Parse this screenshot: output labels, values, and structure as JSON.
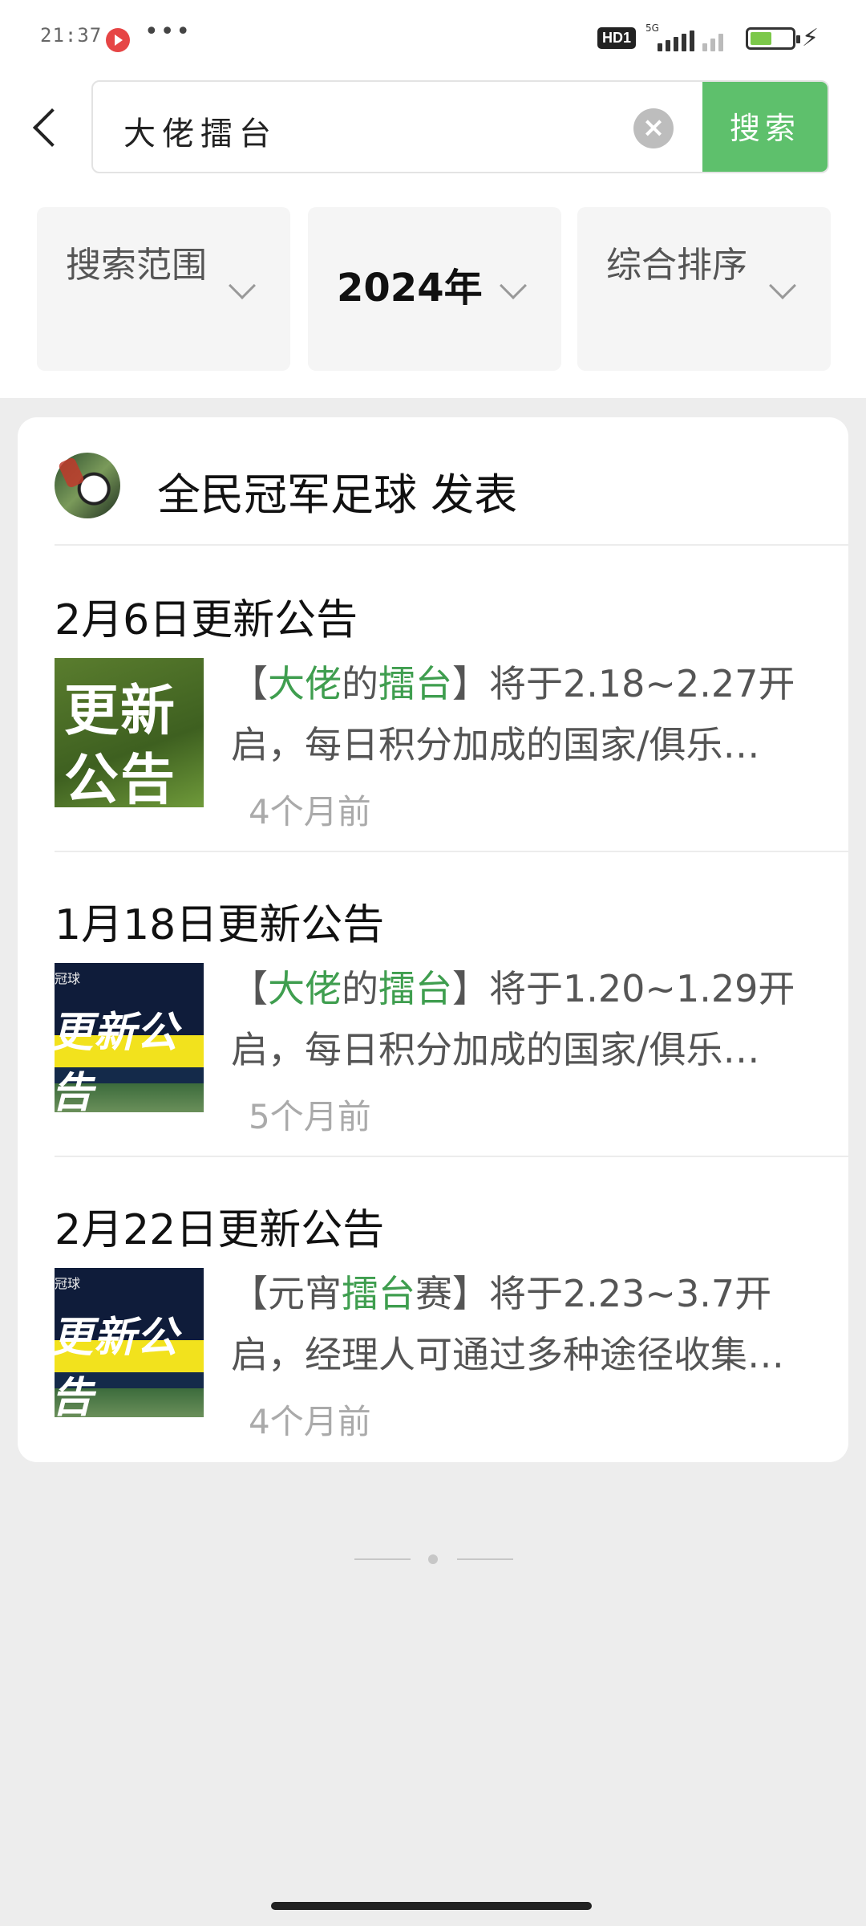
{
  "status_bar": {
    "time": "21:37",
    "more": "•••",
    "hd_badge": "HD1",
    "network": "5G",
    "app_icon": "play-app-icon",
    "battery_icon": "battery-icon",
    "charging_icon": "lightning-icon"
  },
  "search": {
    "query": "大佬擂台",
    "button_label": "搜索",
    "back_icon": "back-arrow-icon",
    "clear_icon": "clear-icon"
  },
  "filters": [
    {
      "label": "搜索范围"
    },
    {
      "label": "2024年"
    },
    {
      "label": "综合排序"
    }
  ],
  "card": {
    "publisher": "全民冠军足球 发表",
    "items": [
      {
        "title": "2月6日更新公告",
        "thumb_text_1": "更新",
        "thumb_text_2": "公告",
        "desc_pre": "【",
        "desc_hl1": "大佬",
        "desc_mid": "的",
        "desc_hl2": "擂台",
        "desc_post": "】将于2.18~2.27开",
        "desc_line2": "启，每日积分加成的国家/俱乐…",
        "time": "4个月前"
      },
      {
        "title": "1月18日更新公告",
        "thumb_small": "冠球",
        "thumb_text": "更新公告",
        "desc_pre": "【",
        "desc_hl1": "大佬",
        "desc_mid": "的",
        "desc_hl2": "擂台",
        "desc_post": "】将于1.20~1.29开",
        "desc_line2": "启，每日积分加成的国家/俱乐…",
        "time": "5个月前"
      },
      {
        "title": "2月22日更新公告",
        "thumb_small": "冠球",
        "thumb_text": "更新公告",
        "desc_pre": "【元宵",
        "desc_hl1": "擂台",
        "desc_post": "赛】将于2.23~3.7开",
        "desc_line2": "启，经理人可通过多种途径收集…",
        "time": "4个月前"
      }
    ]
  },
  "colors": {
    "accent": "#5ec06c",
    "highlight": "#3f9e4f",
    "background": "#ededed"
  }
}
